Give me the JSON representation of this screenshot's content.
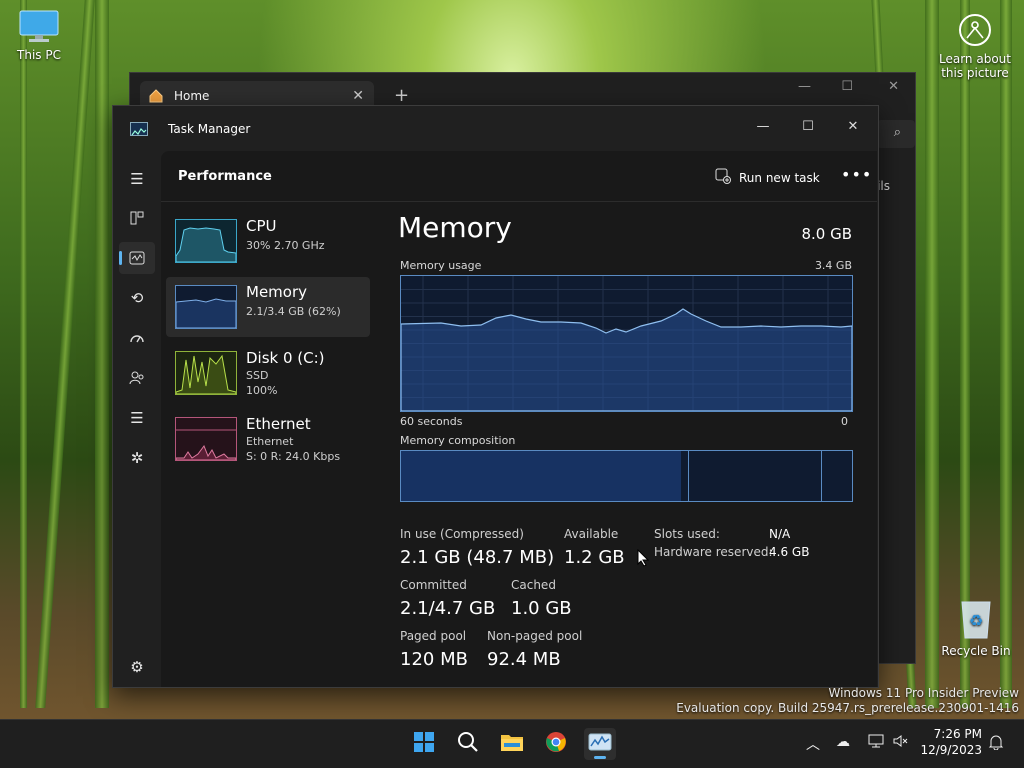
{
  "desktop": {
    "this_pc_label": "This PC",
    "learn_label_line1": "Learn about",
    "learn_label_line2": "this picture",
    "recycle_bin_label": "Recycle Bin",
    "watermark_line1": "Windows 11 Pro Insider Preview",
    "watermark_line2": "Evaluation copy. Build 25947.rs_prerelease.230901-1416"
  },
  "explorer": {
    "tab_title": "Home",
    "side_text": "ils"
  },
  "task_manager": {
    "title": "Task Manager",
    "page_title": "Performance",
    "run_new_task": "Run new task",
    "perf_items": [
      {
        "name": "CPU",
        "sub1": "30%  2.70 GHz",
        "sub2": ""
      },
      {
        "name": "Memory",
        "sub1": "2.1/3.4 GB (62%)",
        "sub2": ""
      },
      {
        "name": "Disk 0 (C:)",
        "sub1": "SSD",
        "sub2": "100%"
      },
      {
        "name": "Ethernet",
        "sub1": "Ethernet",
        "sub2": "S: 0  R: 24.0 Kbps"
      }
    ],
    "detail": {
      "title": "Memory",
      "total": "8.0 GB",
      "usage_label": "Memory usage",
      "usage_max": "3.4 GB",
      "time_left": "60 seconds",
      "time_right": "0",
      "composition_label": "Memory composition",
      "in_use_label": "In use (Compressed)",
      "in_use_value": "2.1 GB (48.7 MB)",
      "available_label": "Available",
      "available_value": "1.2 GB",
      "committed_label": "Committed",
      "committed_value": "2.1/4.7 GB",
      "cached_label": "Cached",
      "cached_value": "1.0 GB",
      "paged_label": "Paged pool",
      "paged_value": "120 MB",
      "nonpaged_label": "Non-paged pool",
      "nonpaged_value": "92.4 MB",
      "slots_label": "Slots used:",
      "slots_value": "N/A",
      "hw_label": "Hardware reserved:",
      "hw_value": "4.6 GB"
    }
  },
  "taskbar": {
    "time": "7:26 PM",
    "date": "12/9/2023"
  },
  "colors": {
    "accent": "#5eb4f0",
    "graph_border": "#5a8bc2",
    "graph_fill": "#0f1b30"
  }
}
